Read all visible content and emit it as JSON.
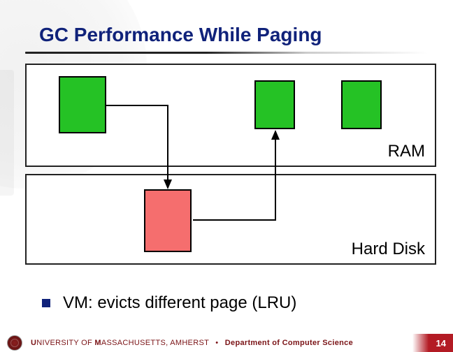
{
  "title": "GC Performance While Paging",
  "regions": {
    "ram_label": "RAM",
    "disk_label": "Hard Disk"
  },
  "blocks": {
    "ram": [
      {
        "id": "ram-block-1",
        "color": "green"
      },
      {
        "id": "ram-block-2",
        "color": "green"
      },
      {
        "id": "ram-block-3",
        "color": "green"
      }
    ],
    "disk": [
      {
        "id": "disk-block-1",
        "color": "red"
      }
    ]
  },
  "arrows": [
    {
      "from": "ram-block-1",
      "to": "disk-block-1"
    },
    {
      "from": "disk-block-1",
      "to": "ram-block-2"
    }
  ],
  "bullet": {
    "text": "VM: evicts different page (LRU)"
  },
  "footer": {
    "university_caps": "U",
    "university_rest": "NIVERSITY OF ",
    "mass_caps": "M",
    "mass_rest": "ASSACHUSETTS",
    "amherst": ", AMHERST",
    "separator": "•",
    "department": "Department of Computer Science",
    "page_number": "14"
  }
}
